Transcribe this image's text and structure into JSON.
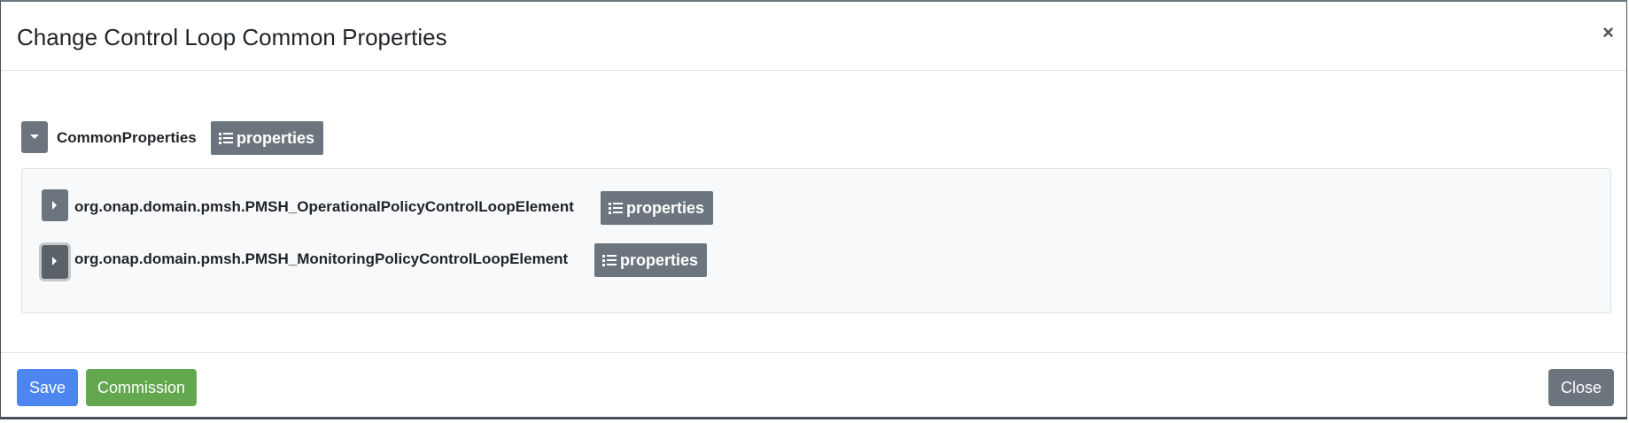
{
  "modal": {
    "title": "Change Control Loop Common Properties",
    "close_symbol": "×"
  },
  "tree": {
    "root": {
      "label": "CommonProperties",
      "properties_label": "properties",
      "expanded": true
    },
    "children": [
      {
        "label": "org.onap.domain.pmsh.PMSH_OperationalPolicyControlLoopElement",
        "properties_label": "properties",
        "expanded": false
      },
      {
        "label": "org.onap.domain.pmsh.PMSH_MonitoringPolicyControlLoopElement",
        "properties_label": "properties",
        "expanded": false
      }
    ]
  },
  "footer": {
    "save_label": "Save",
    "commission_label": "Commission",
    "close_label": "Close"
  },
  "colors": {
    "primary": "#4d86f0",
    "success": "#63a84e",
    "secondary": "#6c757d"
  },
  "icons": {
    "expanded": "caret-down-icon",
    "collapsed": "caret-right-icon",
    "properties": "list-icon",
    "close": "close-icon"
  }
}
